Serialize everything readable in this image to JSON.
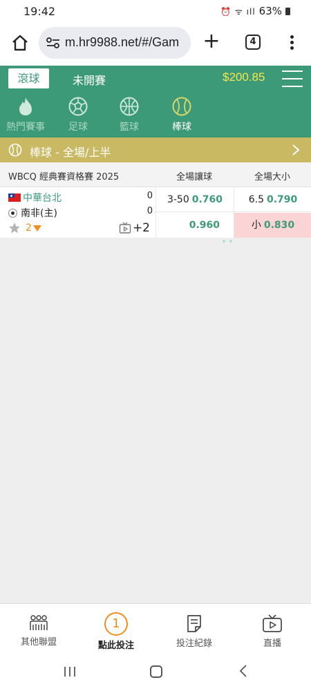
{
  "status_bar": {
    "time": "19:42",
    "signal_icons": "⏰ ᯤ ıll",
    "battery": "63%"
  },
  "browser": {
    "url": "m.hr9988.net/#/Gam",
    "tab_count": "4"
  },
  "header": {
    "live_label": "滾球",
    "upcoming_label": "未開賽",
    "balance": "$200.85"
  },
  "sport_tabs": [
    {
      "label": "熱門賽事",
      "icon": "flame-icon"
    },
    {
      "label": "足球",
      "icon": "soccer-ball-icon"
    },
    {
      "label": "籃球",
      "icon": "basketball-icon"
    },
    {
      "label": "棒球",
      "icon": "baseball-icon",
      "active": true
    }
  ],
  "section": {
    "title": "棒球 - 全場/上半"
  },
  "league": {
    "name": "WBCQ 經典賽資格賽 2025",
    "col_handicap": "全場讓球",
    "col_total": "全場大小"
  },
  "match": {
    "home_team": "中華台北",
    "away_team": "南非(主)",
    "home_score": "0",
    "away_score": "0",
    "favorite_count": "2",
    "more_markets": "+2",
    "handicap": {
      "line": "3-50",
      "top_price": "0.760",
      "bottom_price": "0.960"
    },
    "total": {
      "line": "6.5",
      "top_price": "0.790",
      "bottom_label": "小",
      "bottom_price": "0.830"
    }
  },
  "bottom_nav": [
    {
      "label": "其他聯盟",
      "icon": "leagues-icon"
    },
    {
      "label": "點此投注",
      "badge": "1",
      "active": true
    },
    {
      "label": "投注紀錄",
      "icon": "bet-record-icon"
    },
    {
      "label": "直播",
      "icon": "live-tv-icon"
    }
  ],
  "colors": {
    "brand_green": "#3d9a78",
    "gold": "#c9b962",
    "balance_yellow": "#f5e84a",
    "accent_orange": "#f28c1c",
    "highlight_pink": "#fbd5d5"
  }
}
